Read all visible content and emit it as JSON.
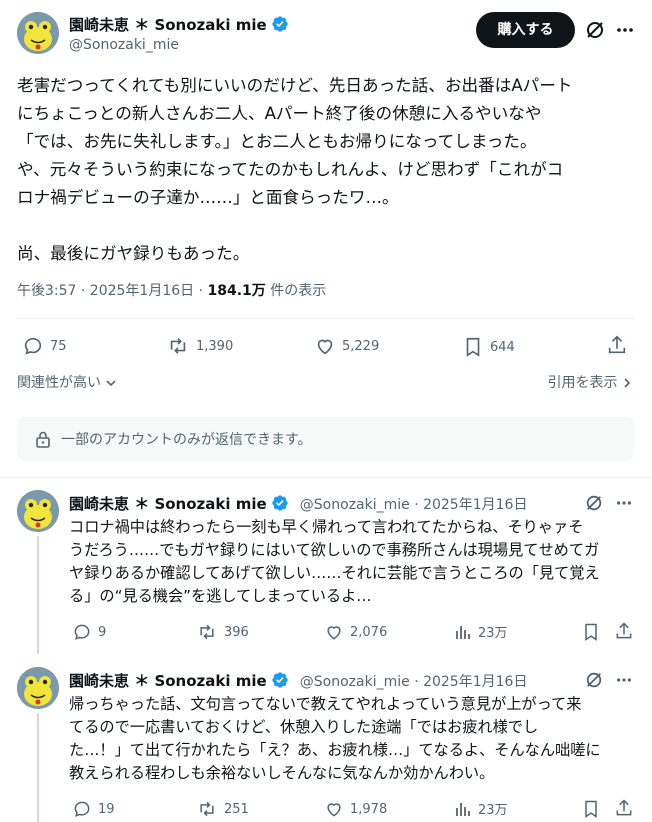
{
  "author": {
    "name": "園崎未恵 ＊ Sonozaki mie",
    "handle": "@Sonozaki_mie"
  },
  "header": {
    "buy_label": "購入する",
    "grok_icon": "slash-circle-icon",
    "more_icon": "more-dots-icon"
  },
  "tweet": {
    "text": "老害だつってくれても別にいいのだけど、先日あった話、お出番はAパート\nにちょこっとの新人さんお二人、Aパート終了後の休憩に入るやいなや\n「では、お先に失礼します。」とお二人ともお帰りになってしまった。\nや、元々そういう約束になってたのかもしれんよ、けど思わず「これがコ\nロナ禍デビューの子達か……」と面食らったワ…。\n\n尚、最後にガヤ録りもあった。",
    "time": "午後3:57 · 2025年1月16日 · ",
    "views": "184.1万",
    "views_suffix": " 件の表示",
    "replies": "75",
    "retweets": "1,390",
    "likes": "5,229",
    "bookmarks": "644"
  },
  "controls": {
    "sort_label": "関連性が高い",
    "quotes_label": "引用を表示",
    "reply_restriction": "一部のアカウントのみが返信できます。"
  },
  "replies": [
    {
      "name": "園崎未恵 ＊ Sonozaki mie",
      "handle_date": "@Sonozaki_mie · 2025年1月16日",
      "text": "コロナ禍中は終わったら一刻も早く帰れって言われてたからね、そりゃァそ\nうだろう……でもガヤ録りにはいて欲しいので事務所さんは現場見てせめてガ\nヤ録りあるか確認してあげて欲しい……それに芸能で言うところの「見て覚え\nる」の“見る機会”を逃してしまっているよ…",
      "replies": "9",
      "retweets": "396",
      "likes": "2,076",
      "views": "23万"
    },
    {
      "name": "園崎未恵 ＊ Sonozaki mie",
      "handle_date": "@Sonozaki_mie · 2025年1月16日",
      "text": "帰っちゃった話、文句言ってないで教えてやれよっていう意見が上がって来\nてるので一応書いておくけど、休憩入りした途端「ではお疲れ様でし\nた…！」て出て行かれたら「え？あ、お疲れ様…」てなるよ、そんなん咄嗟に\n教えられる程わしも余裕ないしそんなに気なんか効かんわい。",
      "replies": "19",
      "retweets": "251",
      "likes": "1,978",
      "views": "23万"
    }
  ],
  "colors": {
    "text": "#0f1419",
    "secondary": "#536471",
    "verified": "#1d9bf0",
    "divider": "#eff3f4"
  }
}
